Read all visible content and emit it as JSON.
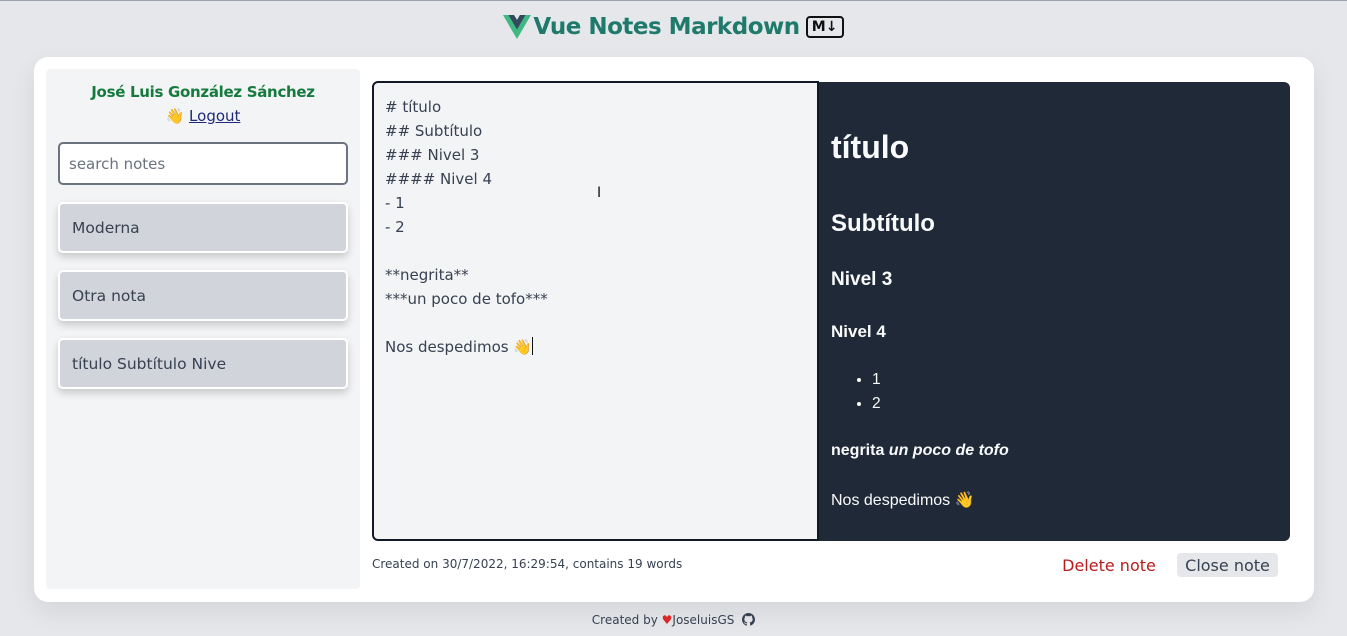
{
  "header": {
    "title": "Vue Notes Markdown",
    "markdown_badge": "M↓"
  },
  "sidebar": {
    "user_name": "José Luis González Sánchez",
    "wave_emoji": "👋",
    "logout_label": "Logout",
    "search": {
      "placeholder": "search notes",
      "value": ""
    },
    "notes": [
      {
        "label": "Moderna"
      },
      {
        "label": "Otra nota"
      },
      {
        "label": "título Subtítulo Nive"
      }
    ]
  },
  "editor": {
    "content": "# título\n## Subtítulo\n### Nivel 3\n#### Nivel 4\n- 1\n- 2\n\n**negrita**\n***un poco de tofo***\n\nNos despedimos 👋"
  },
  "preview": {
    "h1": "título",
    "h2": "Subtítulo",
    "h3": "Nivel 3",
    "h4": "Nivel 4",
    "list": [
      "1",
      "2"
    ],
    "bold": "negrita",
    "bold_italic": "un poco de tofo",
    "last_paragraph": "Nos despedimos 👋"
  },
  "note_meta": {
    "text": "Created on 30/7/2022, 16:29:54, contains 19 words"
  },
  "actions": {
    "delete_label": "Delete note",
    "close_label": "Close note"
  },
  "footer": {
    "created_by": "Created by",
    "author": "JoseluisGS"
  },
  "colors": {
    "background": "#e5e7eb",
    "title": "#1f7a6c",
    "user_name": "#157a3e",
    "preview_bg": "#1f2937",
    "delete": "#b91c1c",
    "heart": "#dc2626"
  },
  "icons": [
    "vue-logo-icon",
    "markdown-icon",
    "waving-hand-icon",
    "heart-icon",
    "github-icon",
    "text-cursor-icon"
  ]
}
